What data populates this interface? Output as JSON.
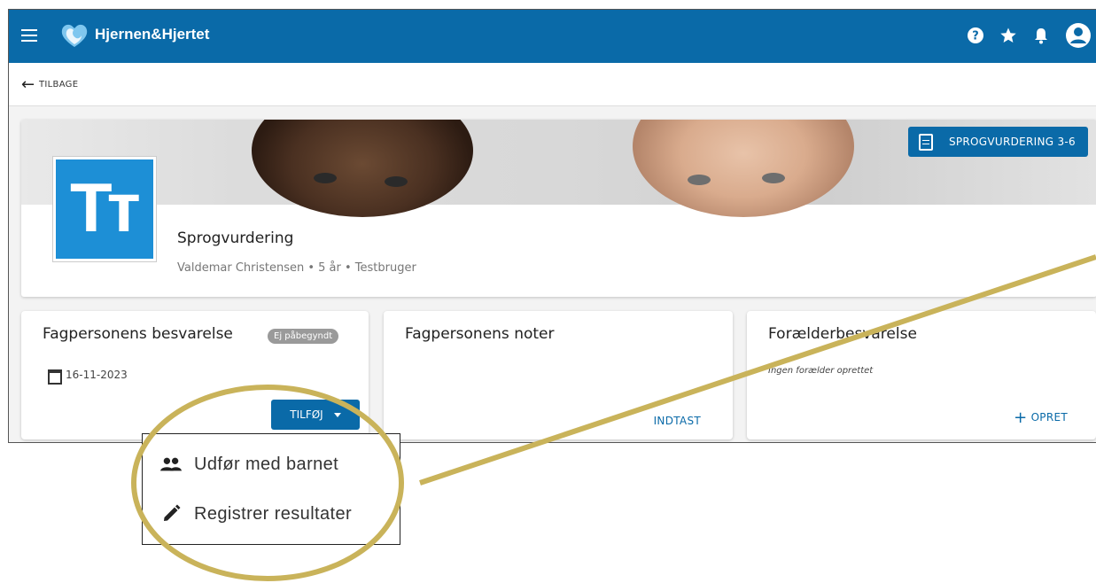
{
  "topbar": {
    "brand": "Hjernen&Hjertet"
  },
  "back": {
    "label": "TILBAGE"
  },
  "header": {
    "badge": "SPROGVURDERING 3-6",
    "logo_text": "Tт",
    "title": "Sprogvurdering",
    "subtitle": "Valdemar Christensen • 5 år • Testbruger"
  },
  "cards": {
    "fagperson": {
      "title": "Fagpersonens besvarelse",
      "status": "Ej påbegyndt",
      "date": "16-11-2023",
      "button": "TILFØJ"
    },
    "noter": {
      "title": "Fagpersonens noter",
      "button": "INDTAST"
    },
    "foraelder": {
      "title": "Forælderbesvarelse",
      "note": "Ingen forælder oprettet",
      "button": "OPRET"
    }
  },
  "menu": {
    "items": [
      {
        "label": "Udfør med barnet",
        "icon": "people-icon"
      },
      {
        "label": "Registrer resultater",
        "icon": "pencil-icon"
      }
    ]
  },
  "colors": {
    "primary": "#0a6aa8",
    "highlight": "#c9b35a"
  }
}
